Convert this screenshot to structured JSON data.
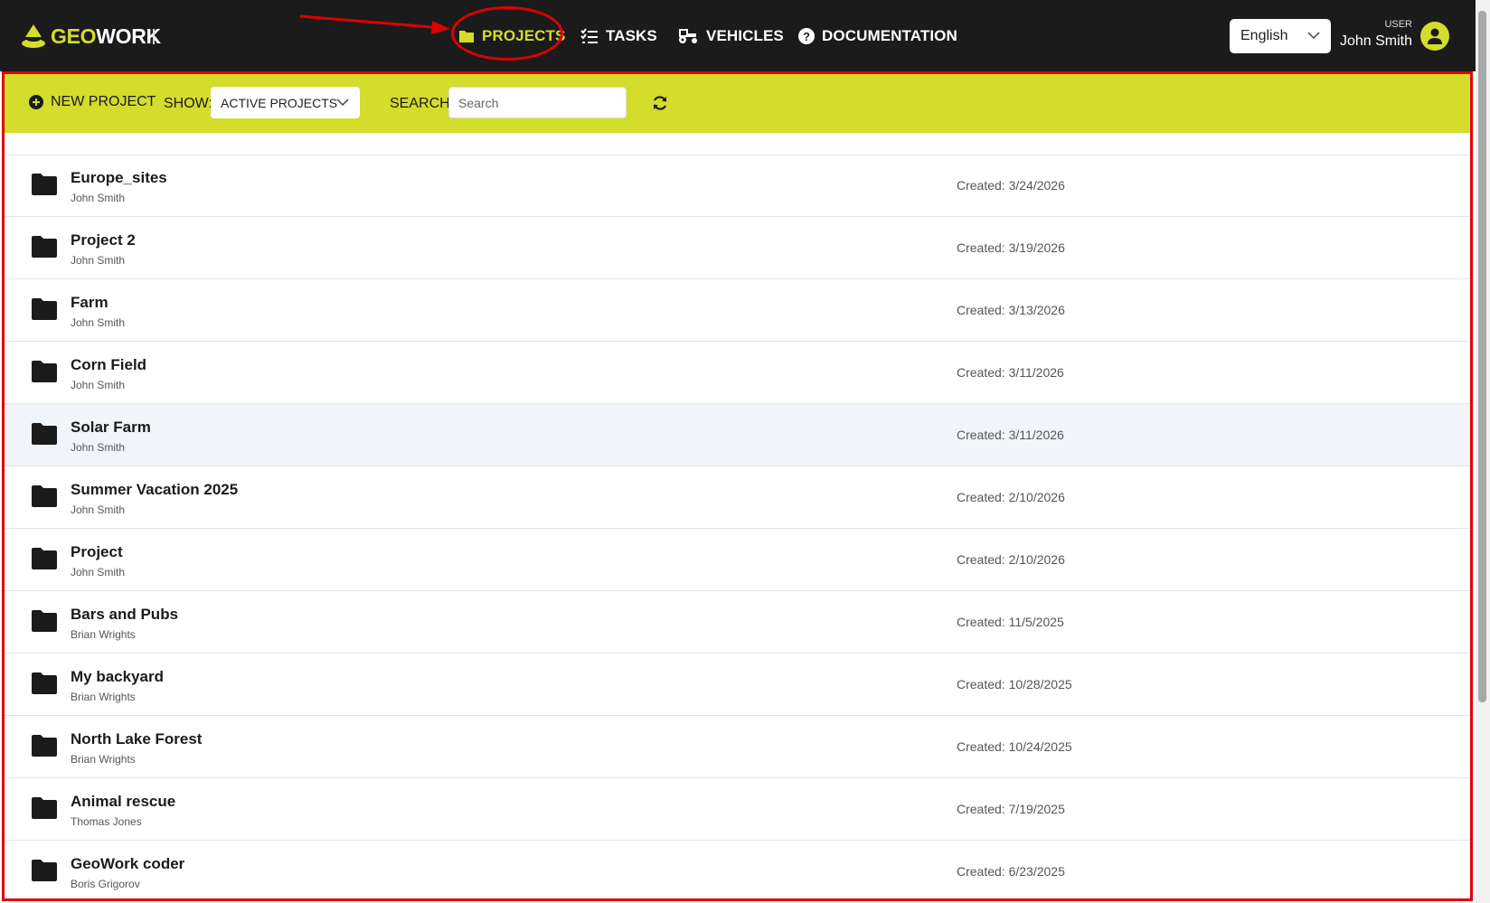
{
  "header": {
    "logo_geo": "GEO",
    "logo_work": "WORK",
    "nav": [
      {
        "label": "PROJECTS",
        "icon": "folder-icon",
        "active": true
      },
      {
        "label": "TASKS",
        "icon": "checklist-icon",
        "active": false
      },
      {
        "label": "VEHICLES",
        "icon": "tractor-icon",
        "active": false
      },
      {
        "label": "DOCUMENTATION",
        "icon": "question-circle-icon",
        "active": false
      }
    ],
    "language": "English",
    "user_role": "USER",
    "user_name": "John Smith"
  },
  "toolbar": {
    "new_project_label": "NEW PROJECT",
    "show_label": "SHOW:",
    "show_value": "ACTIVE PROJECTS",
    "search_label": "SEARCH:",
    "search_placeholder": "Search"
  },
  "projects": [
    {
      "name": "Europe_sites",
      "owner": "John Smith",
      "created": "Created: 3/24/2026"
    },
    {
      "name": "Project 2",
      "owner": "John Smith",
      "created": "Created: 3/19/2026"
    },
    {
      "name": "Farm",
      "owner": "John Smith",
      "created": "Created: 3/13/2026"
    },
    {
      "name": "Corn Field",
      "owner": "John Smith",
      "created": "Created: 3/11/2026"
    },
    {
      "name": "Solar Farm",
      "owner": "John Smith",
      "created": "Created: 3/11/2026"
    },
    {
      "name": "Summer Vacation 2025",
      "owner": "John Smith",
      "created": "Created: 2/10/2026"
    },
    {
      "name": "Project",
      "owner": "John Smith",
      "created": "Created: 2/10/2026"
    },
    {
      "name": "Bars and Pubs",
      "owner": "Brian Wrights",
      "created": "Created: 11/5/2025"
    },
    {
      "name": "My backyard",
      "owner": "Brian Wrights",
      "created": "Created: 10/28/2025"
    },
    {
      "name": "North Lake Forest",
      "owner": "Brian Wrights",
      "created": "Created: 10/24/2025"
    },
    {
      "name": "Animal rescue",
      "owner": "Thomas Jones",
      "created": "Created: 7/19/2025"
    },
    {
      "name": "GeoWork coder",
      "owner": "Boris Grigorov",
      "created": "Created: 6/23/2025"
    }
  ],
  "colors": {
    "accent": "#d4dc2c",
    "header_bg": "#1b1b1b",
    "annotation": "#e00000"
  }
}
